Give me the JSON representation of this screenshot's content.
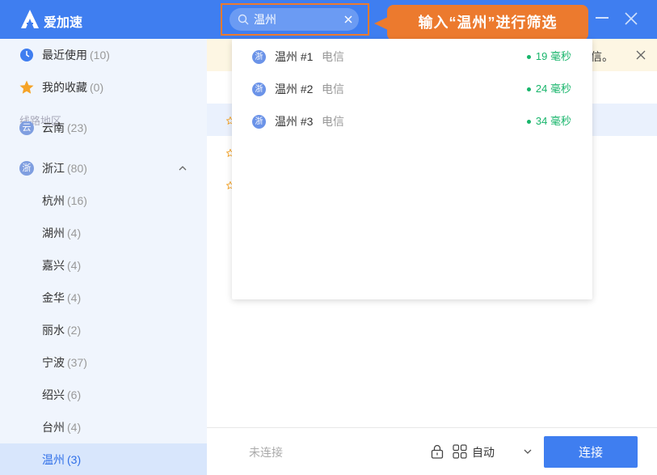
{
  "app": {
    "name": "爱加速"
  },
  "search": {
    "value": "温州",
    "placeholder": ""
  },
  "callout": "输入“温州”进行筛选",
  "sidebar": {
    "recent": {
      "label": "最近使用",
      "count": "(10)"
    },
    "favorites": {
      "label": "我的收藏",
      "count": "(0)"
    },
    "section_label": "线路地区",
    "yunnan": {
      "label": "云南",
      "count": "(23)",
      "icon_char": "云"
    },
    "zhejiang": {
      "label": "浙江",
      "count": "(80)",
      "icon_char": "浙"
    },
    "cities": [
      {
        "label": "杭州",
        "count": "(16)"
      },
      {
        "label": "湖州",
        "count": "(4)"
      },
      {
        "label": "嘉兴",
        "count": "(4)"
      },
      {
        "label": "金华",
        "count": "(4)"
      },
      {
        "label": "丽水",
        "count": "(2)"
      },
      {
        "label": "宁波",
        "count": "(37)"
      },
      {
        "label": "绍兴",
        "count": "(6)"
      },
      {
        "label": "台州",
        "count": "(4)"
      },
      {
        "label": "温州",
        "count": "(3)"
      }
    ]
  },
  "notice": {
    "tail": "信。"
  },
  "dropdown": [
    {
      "icon_char": "浙",
      "name": "温州 #1",
      "isp": "电信",
      "ping": "19 毫秒"
    },
    {
      "icon_char": "浙",
      "name": "温州 #2",
      "isp": "电信",
      "ping": "24 毫秒"
    },
    {
      "icon_char": "浙",
      "name": "温州 #3",
      "isp": "电信",
      "ping": "34 毫秒"
    }
  ],
  "footer": {
    "status": "未连接",
    "mode": "自动",
    "connect": "连接"
  },
  "colors": {
    "brand": "#3f7ef0",
    "accent": "#ec7a2e",
    "ping": "#18b56b"
  }
}
